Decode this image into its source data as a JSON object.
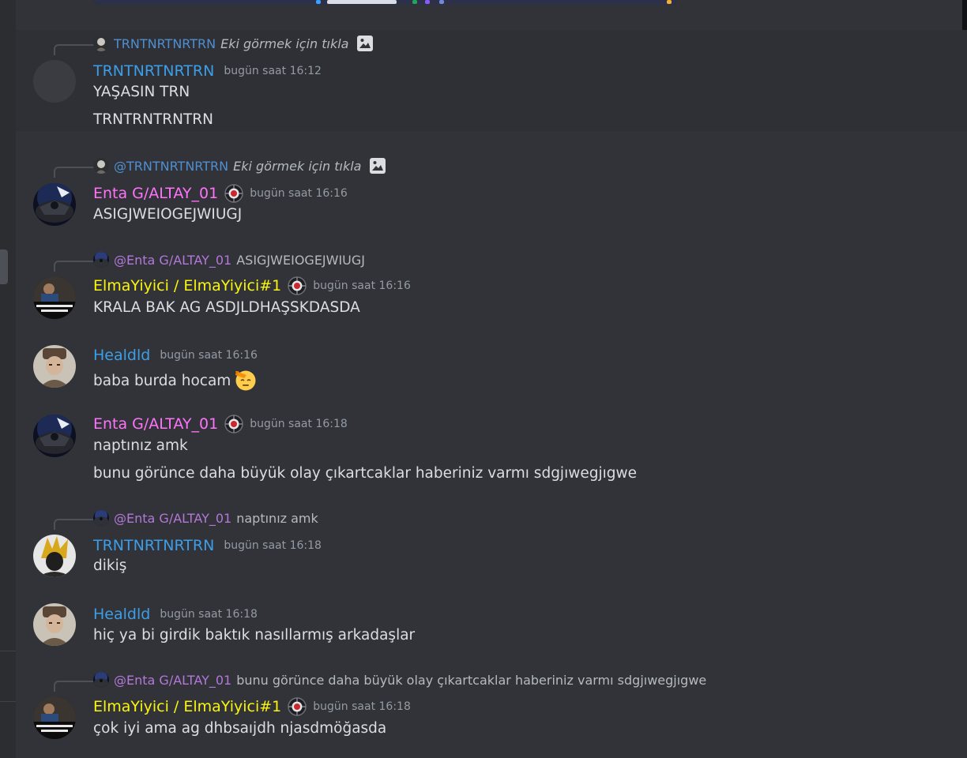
{
  "colors": {
    "background": "#313338",
    "text": "#dbdee1",
    "muted": "#949ba4",
    "role_blue": "#3d9ee8",
    "role_pink": "#ff73fa",
    "role_yellow": "#f9f50f",
    "role_purple": "#b378d9",
    "mention_blue": "#4f8fd0"
  },
  "messages": [
    {
      "reply": {
        "name": "TRNTNRTNRTRN",
        "text": "Eki görmek için tıkla",
        "italic": true,
        "attachment_icon": "image-icon"
      },
      "author": "TRNTNRTNRTRN",
      "time": "bugün saat 16:12",
      "avatar": "grey-avatar",
      "lines": [
        "YAŞASIN TRN",
        "TRNTRNTRNTRN"
      ]
    },
    {
      "reply": {
        "name": "@TRNTNRTNRTRN",
        "text": "Eki görmek için tıkla",
        "italic": true,
        "attachment_icon": "image-icon"
      },
      "author": "Enta G/ALTAY_01",
      "time": "bugün saat 16:16",
      "avatar": "jet-avatar",
      "badge": "server-badge-icon",
      "lines": [
        "ASIGJWEIOGEJWIUGJ"
      ]
    },
    {
      "reply": {
        "name": "@Enta G/ALTAY_01",
        "text": "ASIGJWEIOGEJWIUGJ"
      },
      "author": "ElmaYiyici / ElmaYiyici#1",
      "time": "bugün saat 16:16",
      "avatar": "meme-avatar",
      "badge": "server-badge-icon",
      "lines": [
        "KRALA BAK AG ASDJLDHAŞSKDASDA"
      ]
    },
    {
      "author": "Healdld",
      "time": "bugün saat 16:16",
      "avatar": "portrait-avatar",
      "lines": [
        "baba burda hocam"
      ],
      "emoji": "saluting-face-emoji"
    },
    {
      "author": "Enta G/ALTAY_01",
      "time": "bugün saat 16:18",
      "avatar": "jet-avatar",
      "badge": "server-badge-icon",
      "lines": [
        "naptınız amk",
        "bunu görünce daha büyük olay çıkartcaklar haberiniz varmı sdgjıwegjıgwe"
      ]
    },
    {
      "reply": {
        "name": "@Enta G/ALTAY_01",
        "text": "naptınız amk"
      },
      "author": "TRNTNRTNRTRN",
      "time": "bugün saat 16:18",
      "avatar": "warrior-avatar",
      "lines": [
        "dikiş"
      ]
    },
    {
      "author": "Healdld",
      "time": "bugün saat 16:18",
      "avatar": "portrait-avatar",
      "lines": [
        "hiç ya bi girdik baktık nasıllarmış arkadaşlar"
      ]
    },
    {
      "reply": {
        "name": "@Enta G/ALTAY_01",
        "text": "bunu görünce daha büyük olay çıkartcaklar haberiniz varmı sdgjıwegjıgwe"
      },
      "author": "ElmaYiyici / ElmaYiyici#1",
      "time": "bugün saat 16:18",
      "avatar": "meme-avatar",
      "badge": "server-badge-icon",
      "lines": [
        "çok iyi ama ag dhbsaıjdh njasdmöğasda"
      ]
    }
  ]
}
